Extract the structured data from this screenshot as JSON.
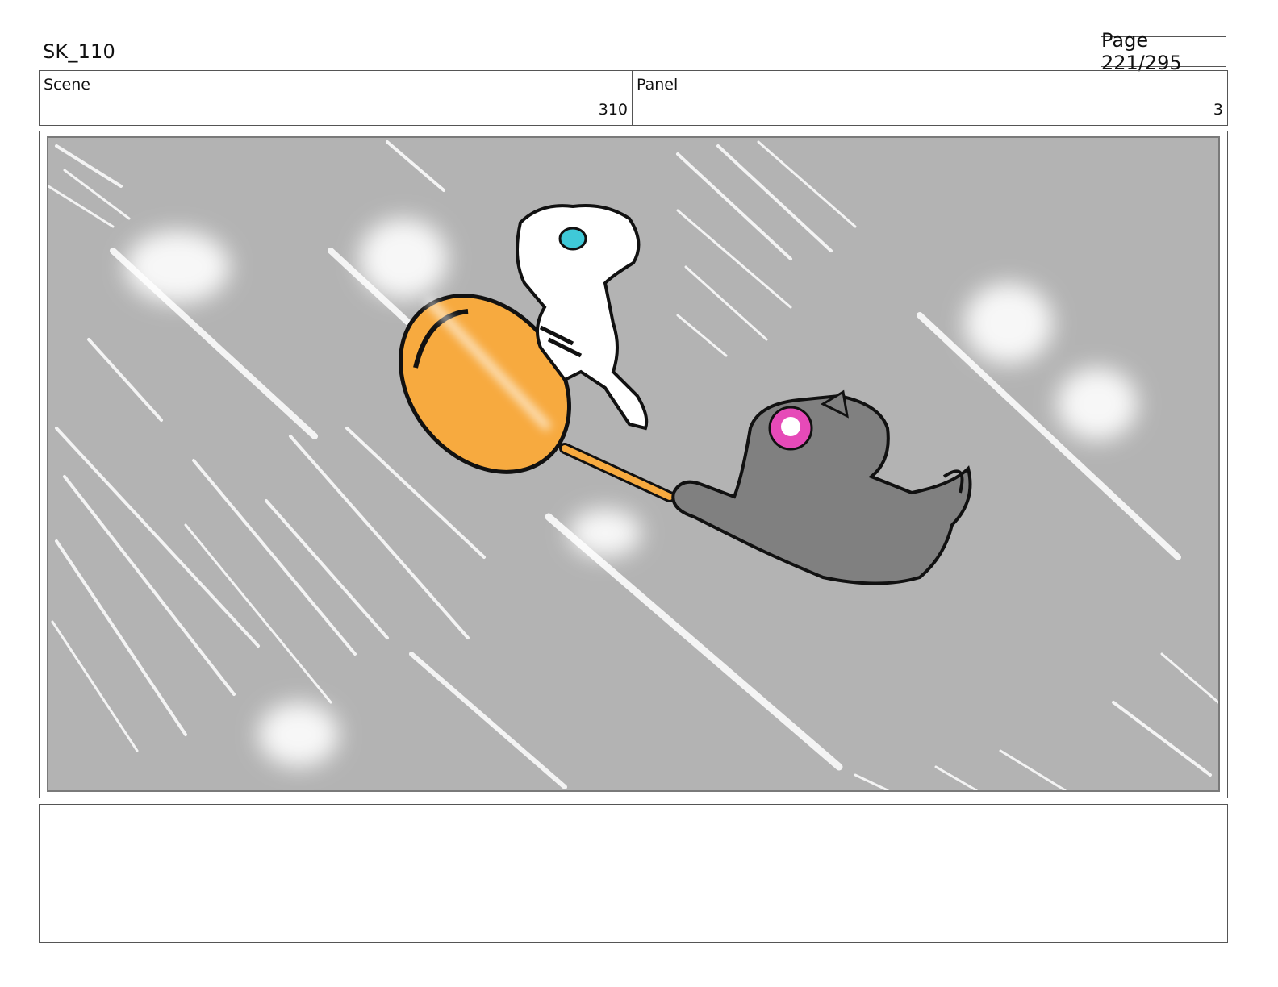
{
  "header": {
    "title": "SK_110",
    "page": "Page 221/295"
  },
  "scene": {
    "label": "Scene",
    "value": "310"
  },
  "panel": {
    "label": "Panel",
    "value": "3"
  },
  "drawing": {
    "background_color": "#b3b3b3",
    "pan_color": "#f7aa3f",
    "gray_cat_color": "#808080",
    "eye_pink": "#e64ab8",
    "eye_cyan": "#3fc9d8"
  },
  "notes": {
    "text": ""
  }
}
